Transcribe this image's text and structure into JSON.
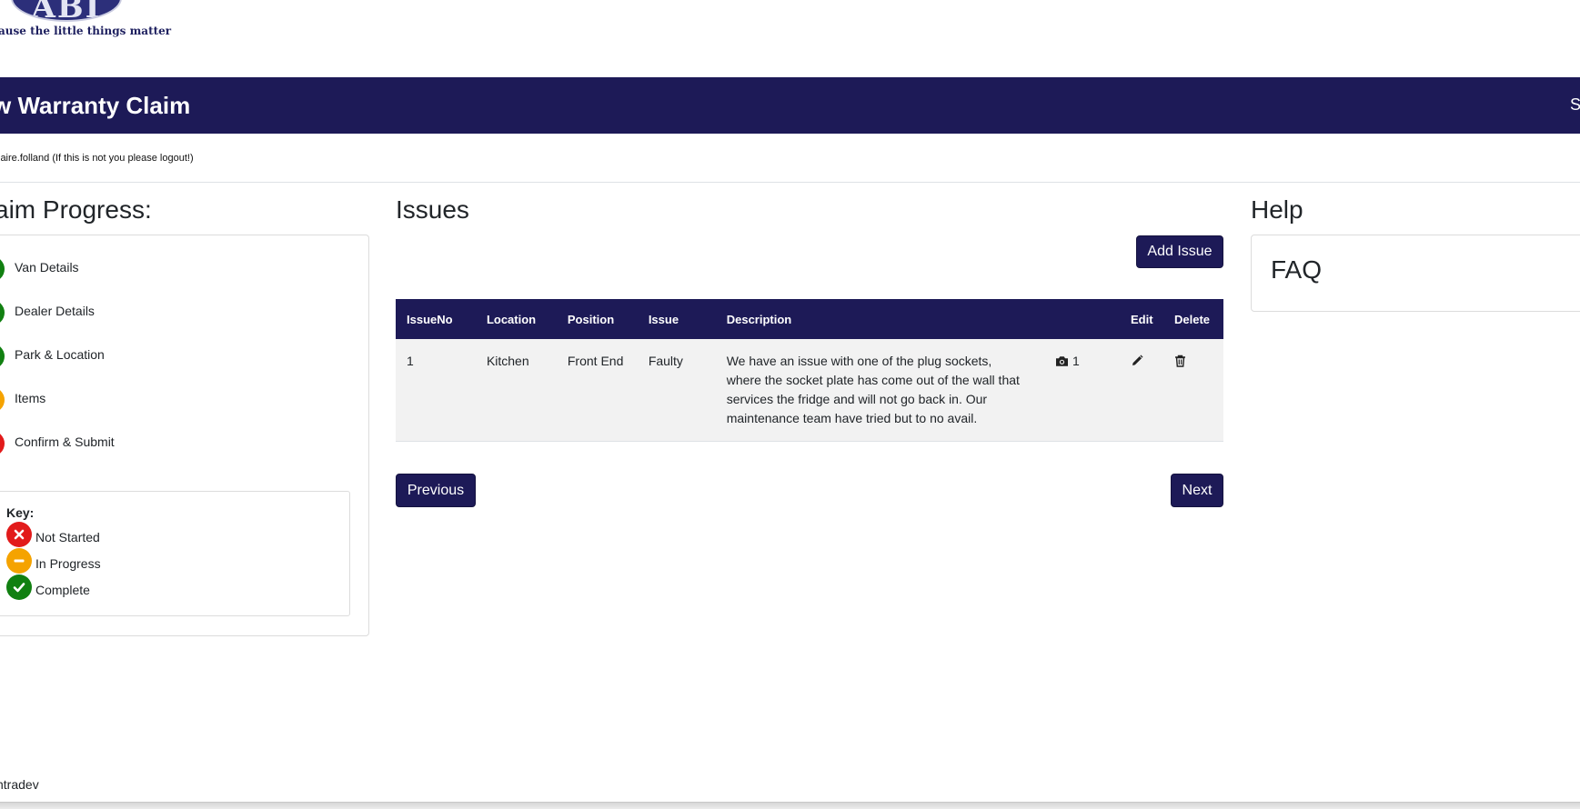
{
  "header": {
    "logo_text": "ABI",
    "tagline": "ause the little things matter",
    "title": "w Warranty Claim",
    "right_text": "S"
  },
  "user_notice": "laire.folland (If this is not you please logout!)",
  "progress": {
    "heading": "aim Progress:",
    "steps": [
      {
        "label": "Van Details",
        "status": "complete"
      },
      {
        "label": "Dealer Details",
        "status": "complete"
      },
      {
        "label": "Park & Location",
        "status": "complete"
      },
      {
        "label": "Items",
        "status": "in-progress"
      },
      {
        "label": "Confirm & Submit",
        "status": "not-started"
      }
    ],
    "key": {
      "title": "Key:",
      "not_started": "Not Started",
      "in_progress": "In Progress",
      "complete": "Complete"
    }
  },
  "issues": {
    "heading": "Issues",
    "add_button": "Add Issue",
    "columns": [
      "IssueNo",
      "Location",
      "Position",
      "Issue",
      "Description",
      "",
      "Edit",
      "Delete"
    ],
    "rows": [
      {
        "issue_no": "1",
        "location": "Kitchen",
        "position": "Front End",
        "issue": "Faulty",
        "description": "We have an issue with one of the plug sockets, where the socket plate has come out of the wall that services the fridge and will not go back in. Our maintenance team have tried but to no avail.",
        "photo_count": "1"
      }
    ],
    "previous_button": "Previous",
    "next_button": "Next"
  },
  "help": {
    "heading": "Help",
    "faq_title": "FAQ"
  },
  "footer": {
    "text": "ntradev"
  },
  "colors": {
    "brand": "#1d1a57",
    "complete": "#118011",
    "in_progress": "#f5a300",
    "not_started": "#e21b1b"
  }
}
